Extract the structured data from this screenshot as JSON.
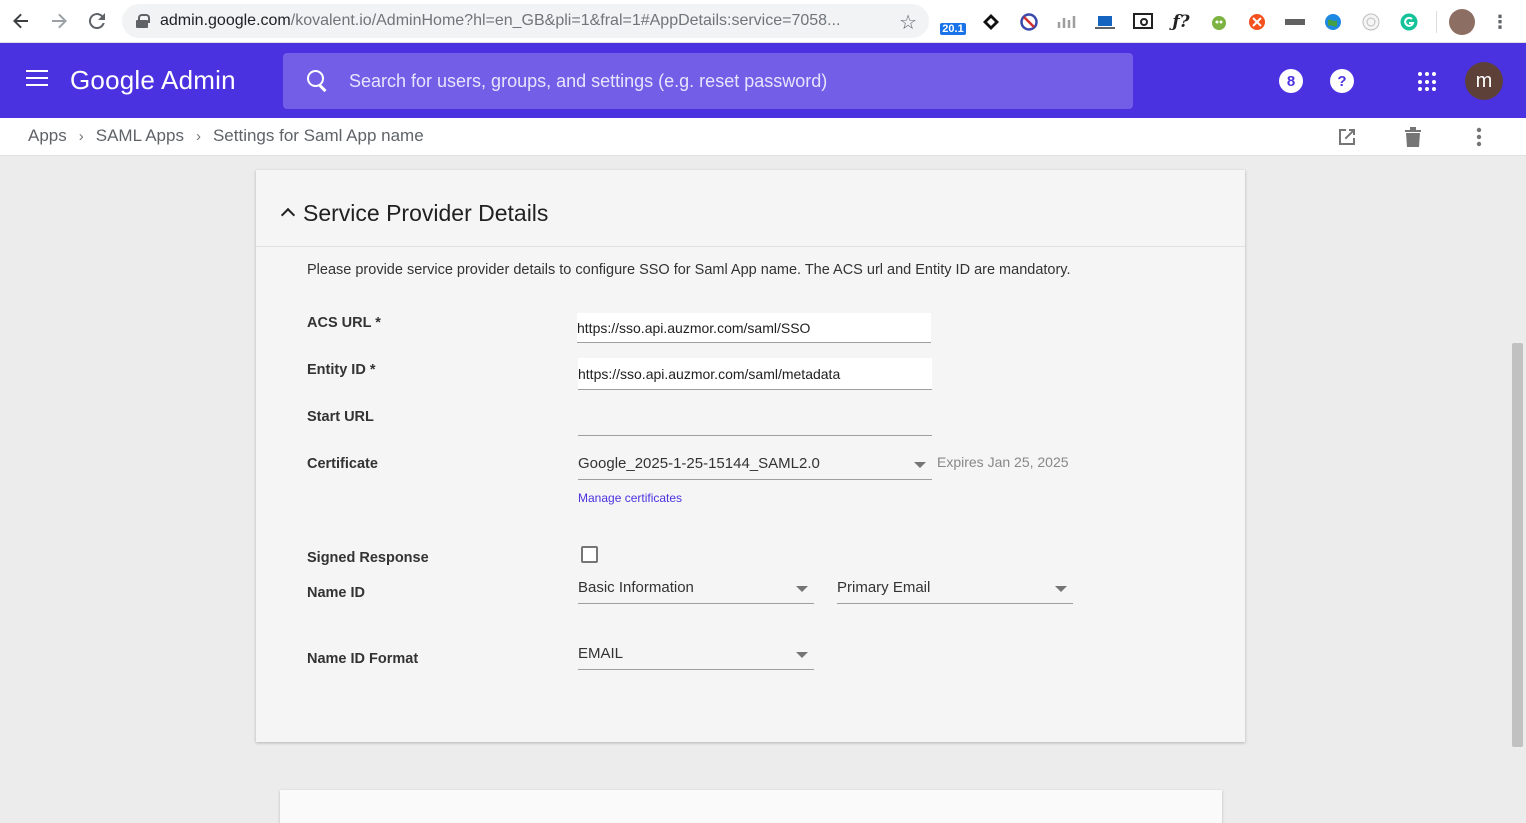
{
  "browser": {
    "url_host": "admin.google.com",
    "url_path": "/kovalent.io/AdminHome?hl=en_GB&pli=1&fral=1#AppDetails:service=7058...",
    "extensions": [
      "20.1",
      "ƒ?"
    ]
  },
  "header": {
    "brand": "Google Admin",
    "search_placeholder": "Search for users, groups, and settings (e.g. reset password)",
    "avatar_letter": "m",
    "notification_count": "8",
    "help_label": "?"
  },
  "breadcrumb": {
    "items": [
      "Apps",
      "SAML Apps",
      "Settings for Saml App name"
    ]
  },
  "card": {
    "title": "Service Provider Details",
    "description": "Please provide service provider details to configure SSO for Saml App name. The ACS url and Entity ID are mandatory.",
    "fields": {
      "acs_url": {
        "label": "ACS URL *",
        "value": "https://sso.api.auzmor.com/saml/SSO"
      },
      "entity_id": {
        "label": "Entity ID *",
        "value": "https://sso.api.auzmor.com/saml/metadata"
      },
      "start_url": {
        "label": "Start URL",
        "value": ""
      },
      "certificate": {
        "label": "Certificate",
        "value": "Google_2025-1-25-15144_SAML2.0",
        "expires": "Expires Jan 25, 2025",
        "manage_link": "Manage certificates"
      },
      "signed_response": {
        "label": "Signed Response",
        "checked": false
      },
      "name_id": {
        "label": "Name ID",
        "category": "Basic Information",
        "attribute": "Primary Email"
      },
      "name_id_format": {
        "label": "Name ID Format",
        "value": "EMAIL"
      }
    }
  },
  "colors": {
    "header": "#4b32e0",
    "search": "#735ee7",
    "link": "#4b32e0"
  }
}
